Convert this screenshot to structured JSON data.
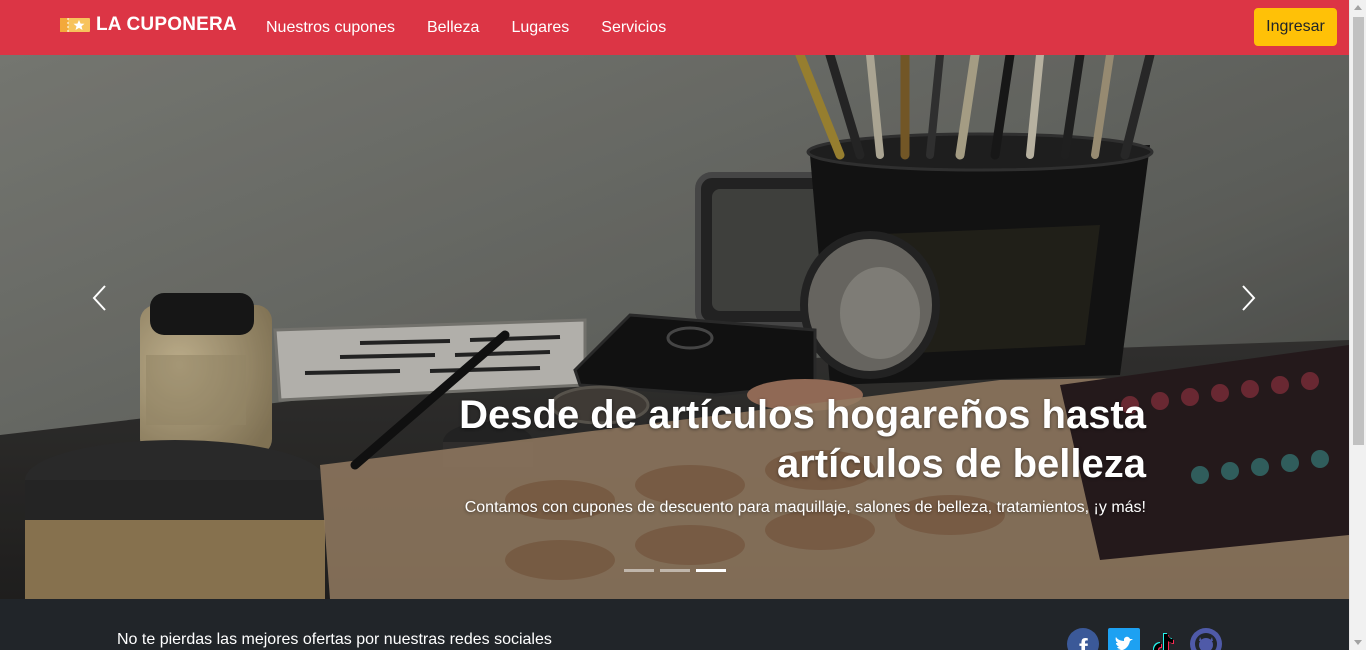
{
  "navbar": {
    "brand": "LA CUPONERA",
    "links": [
      "Nuestros cupones",
      "Belleza",
      "Lugares",
      "Servicios"
    ],
    "login_label": "Ingresar",
    "color": "#dc3545",
    "login_color": "#ffc107"
  },
  "carousel": {
    "title": "Desde de artículos hogareños hasta artículos de belleza",
    "subtitle": "Contamos con cupones de descuento para maquillaje, salones de belleza, tratamientos, ¡y más!",
    "slide_count": 3,
    "active_slide": 3,
    "prev_icon": "chevron-left-icon",
    "next_icon": "chevron-right-icon"
  },
  "footer": {
    "text": "No te pierdas las mejores ofertas por nuestras redes sociales",
    "social": [
      {
        "name": "facebook-icon",
        "color": "#3b5998"
      },
      {
        "name": "twitter-icon",
        "color": "#1da1f2"
      },
      {
        "name": "tiktok-icon",
        "color": "#000000"
      },
      {
        "name": "github-icon",
        "color": "#4f5aa8"
      }
    ],
    "color": "#212529"
  }
}
